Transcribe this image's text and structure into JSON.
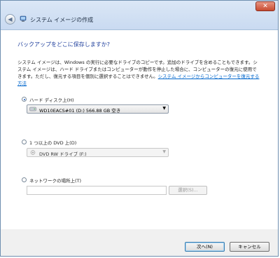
{
  "window": {
    "title": "システム イメージの作成",
    "close_label": "✕"
  },
  "page": {
    "heading": "バックアップをどこに保存しますか?",
    "description": "システム イメージは、Windows の実行に必要なドライブのコピーです。追加のドライブを含めることもできます。システム イメージは、ハード ドライブまたはコンピューターが動作を停止した場合に、コンピューターの復元に使用できます。ただし、復元する項目を個別に選択することはできません。",
    "restore_link": "システム イメージからコンピューターを復元する方法"
  },
  "options": {
    "hard_disk": {
      "label": "ハード ディスク上(H)",
      "selected": "WD10EACS#01 (D:)   566.88 GB 空き",
      "checked": true
    },
    "dvd": {
      "label": "1 つ以上の DVD 上(D)",
      "selected": "DVD RW ドライブ (F:)",
      "checked": false
    },
    "network": {
      "label": "ネットワークの場所上(T)",
      "path_value": "",
      "select_label": "選択(S)...",
      "checked": false
    }
  },
  "footer": {
    "next_label": "次へ(N)",
    "cancel_label": "キャンセル"
  }
}
